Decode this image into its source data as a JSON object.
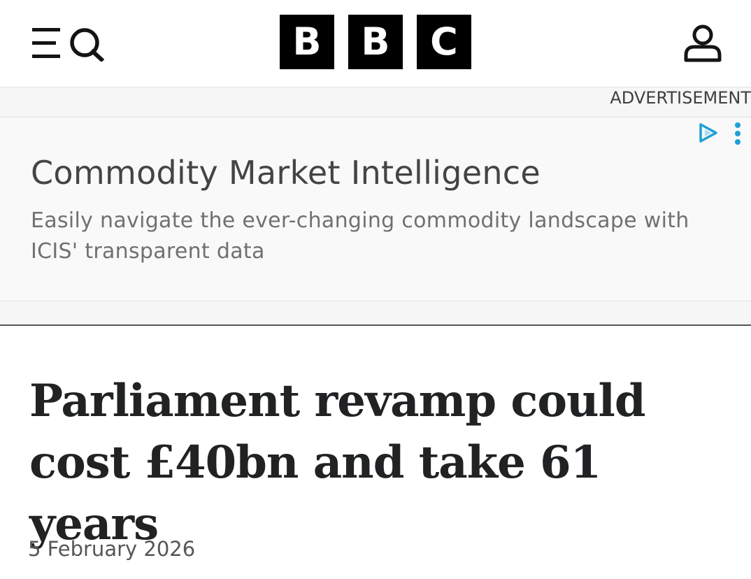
{
  "header": {
    "logo_letters": [
      "B",
      "B",
      "C"
    ],
    "menu_icon": "menu-icon",
    "search_icon": "search-icon",
    "account_icon": "account-icon"
  },
  "advertisement": {
    "label": "ADVERTISEMENT",
    "title": "Commodity Market Intelligence",
    "description": "Easily navigate the ever-changing commodity landscape with ICIS' transparent data",
    "adchoices_icon": "adchoices-icon",
    "options_icon": "more-options-icon",
    "accent_color": "#1fa0d6"
  },
  "article": {
    "headline": "Parliament revamp could cost £40bn and take 61 years",
    "date": "5 February 2026"
  },
  "colors": {
    "logo_background": "#000000",
    "headline_text": "#202224",
    "ad_background": "#f9f9f9"
  }
}
